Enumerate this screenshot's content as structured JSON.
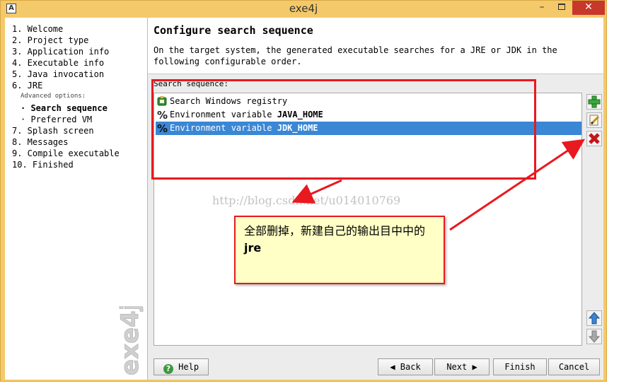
{
  "window": {
    "app_icon": "A",
    "title": "exe4j",
    "minimize_label": "–",
    "close_label": "✕"
  },
  "nav": {
    "items": [
      {
        "label": "1.  Welcome"
      },
      {
        "label": "2.  Project type"
      },
      {
        "label": "3.  Application info"
      },
      {
        "label": "4.  Executable info"
      },
      {
        "label": "5.  Java invocation"
      },
      {
        "label": "6.  JRE"
      }
    ],
    "advanced_label": "Advanced options:",
    "sub_items": [
      {
        "label": "· Search sequence",
        "active": true
      },
      {
        "label": "· Preferred VM",
        "active": false
      }
    ],
    "items_after": [
      {
        "label": "7.  Splash screen"
      },
      {
        "label": "8.  Messages"
      },
      {
        "label": "9.  Compile executable"
      },
      {
        "label": "10.  Finished"
      }
    ],
    "brand_text": "exe4j"
  },
  "page": {
    "title": "Configure search sequence",
    "description": "On the target system, the generated executable searches for a JRE or JDK in the following configurable order.",
    "sequence_label": "Search sequence:"
  },
  "sequence": [
    {
      "icon": "registry-icon",
      "text": "Search Windows registry",
      "bold": ""
    },
    {
      "icon": "percent-icon",
      "text": "Environment variable ",
      "bold": "JAVA_HOME"
    },
    {
      "icon": "percent-icon",
      "text": "Environment variable ",
      "bold": "JDK_HOME",
      "selected": true
    }
  ],
  "side_buttons": {
    "add": "add-icon",
    "edit": "edit-icon",
    "remove": "remove-icon",
    "up": "move-up-icon",
    "down": "move-down-icon"
  },
  "buttons": {
    "help": "Help",
    "back": "Back",
    "next": "Next",
    "finish": "Finish",
    "cancel": "Cancel"
  },
  "annotation": {
    "note_text": "全部删掉，新建自己的输出目中中的",
    "note_bold": "jre",
    "watermark": "http://blog.csdn.net/u014010769",
    "color": "#e8191f"
  },
  "colors": {
    "title_bar": "#f4c96a",
    "selection": "#3a87d6",
    "note_bg": "#ffffc6"
  }
}
